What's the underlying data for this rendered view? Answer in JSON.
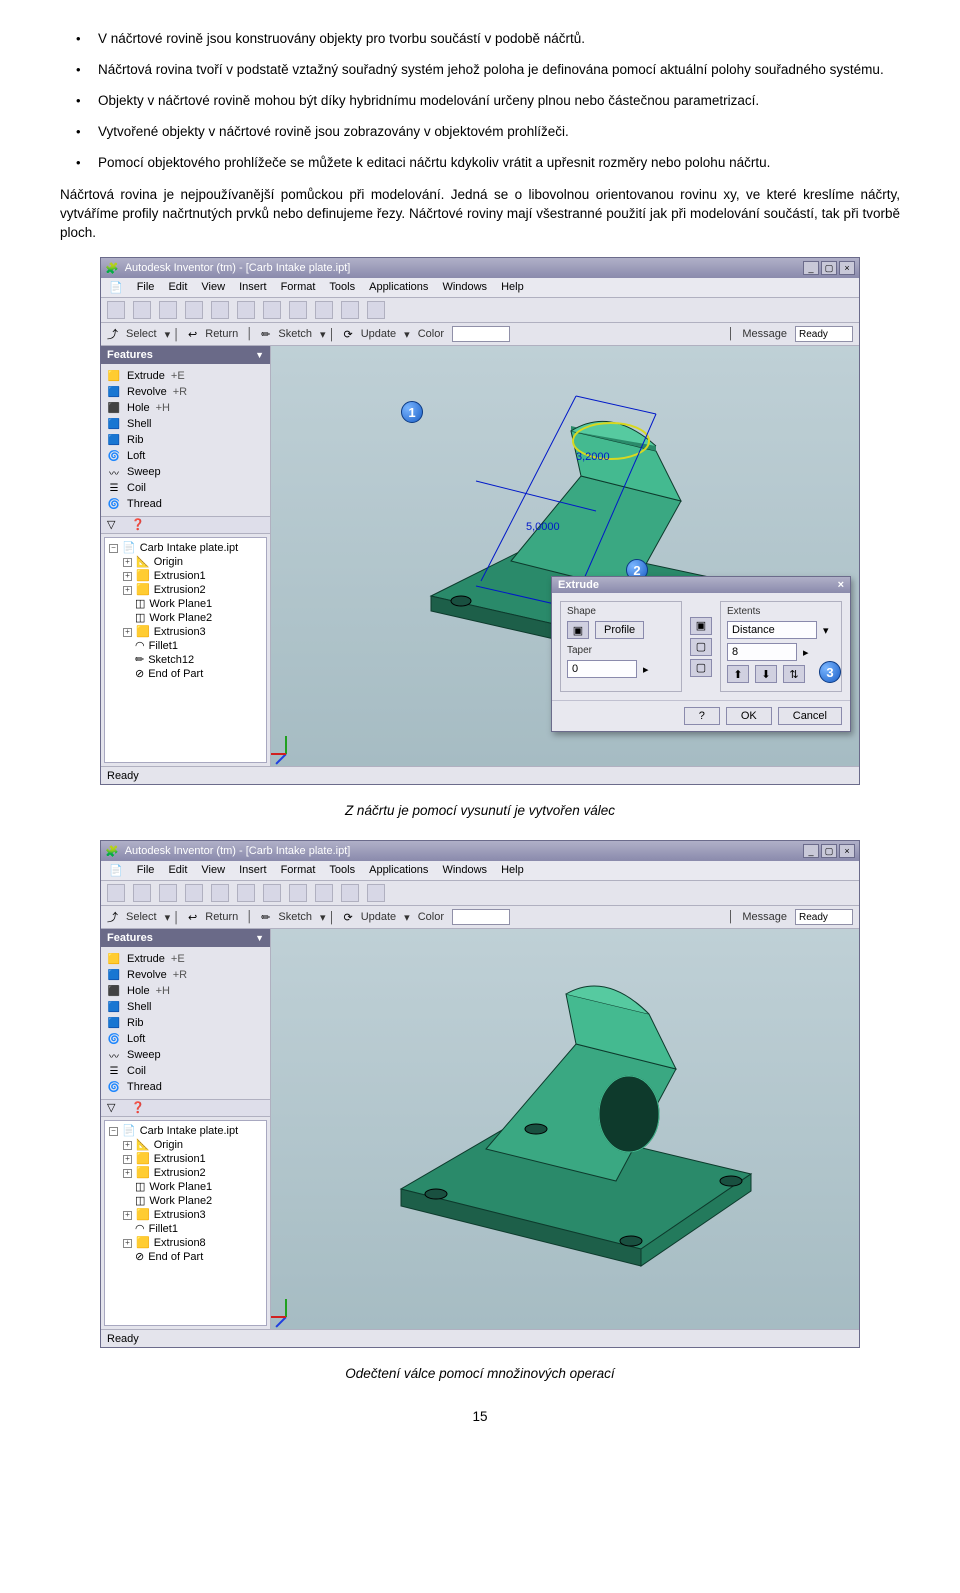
{
  "bullets": [
    "V náčrtové rovině jsou konstruovány objekty pro tvorbu součástí v podobě náčrtů.",
    "Náčrtová rovina tvoří v podstatě vztažný souřadný systém jehož poloha je definována pomocí aktuální polohy souřadného systému.",
    "Objekty v náčrtové rovině mohou být díky hybridnímu modelování určeny plnou nebo částečnou parametrizací.",
    "Vytvořené objekty v náčrtové rovině jsou zobrazovány v objektovém prohlížeči.",
    "Pomocí objektového prohlížeče se můžete k editaci náčrtu kdykoliv vrátit a upřesnit rozměry nebo polohu náčrtu."
  ],
  "paragraph": "Náčrtová rovina je nejpoužívanější pomůckou při modelování. Jedná se o libovolnou orientovanou rovinu xy, ve které kreslíme náčrty, vytváříme profily načrtnutých prvků nebo definujeme řezy. Náčrtové roviny mají všestranné použití jak při modelování součástí, tak při tvorbě ploch.",
  "caption1": "Z náčrtu je pomocí vysunutí je vytvořen válec",
  "caption2": "Odečtení válce pomocí množinových operací",
  "pagenum": "15",
  "app": {
    "title": "Autodesk Inventor (tm) - [Carb Intake plate.ipt]",
    "menus": [
      "File",
      "Edit",
      "View",
      "Insert",
      "Format",
      "Tools",
      "Applications",
      "Windows",
      "Help"
    ],
    "tb2": {
      "select": "Select",
      "return": "Return",
      "sketch": "Sketch",
      "update": "Update",
      "colorLbl": "Color",
      "color": " ",
      "message": "Message",
      "ready": "Ready"
    },
    "panelHead": "Features",
    "features": [
      {
        "icon": "🟨",
        "label": "Extrude",
        "key": "+E"
      },
      {
        "icon": "🟦",
        "label": "Revolve",
        "key": "+R"
      },
      {
        "icon": "⬛",
        "label": "Hole",
        "key": "+H"
      },
      {
        "icon": "🟦",
        "label": "Shell",
        "key": ""
      },
      {
        "icon": "🟦",
        "label": "Rib",
        "key": ""
      },
      {
        "icon": "🌀",
        "label": "Loft",
        "key": ""
      },
      {
        "icon": "〰",
        "label": "Sweep",
        "key": ""
      },
      {
        "icon": "☰",
        "label": "Coil",
        "key": ""
      },
      {
        "icon": "🌀",
        "label": "Thread",
        "key": ""
      }
    ],
    "tree": [
      {
        "pm": "−",
        "indent": 0,
        "icon": "📄",
        "label": "Carb Intake plate.ipt"
      },
      {
        "pm": "+",
        "indent": 1,
        "icon": "📐",
        "label": "Origin"
      },
      {
        "pm": "+",
        "indent": 1,
        "icon": "🟨",
        "label": "Extrusion1"
      },
      {
        "pm": "+",
        "indent": 1,
        "icon": "🟨",
        "label": "Extrusion2"
      },
      {
        "pm": "",
        "indent": 1,
        "icon": "◫",
        "label": "Work Plane1"
      },
      {
        "pm": "",
        "indent": 1,
        "icon": "◫",
        "label": "Work Plane2"
      },
      {
        "pm": "+",
        "indent": 1,
        "icon": "🟨",
        "label": "Extrusion3"
      },
      {
        "pm": "",
        "indent": 1,
        "icon": "◠",
        "label": "Fillet1"
      },
      {
        "pm": "",
        "indent": 1,
        "icon": "✏",
        "label": "Sketch12"
      },
      {
        "pm": "",
        "indent": 1,
        "icon": "⊘",
        "label": "End of Part"
      }
    ],
    "tree2": [
      {
        "pm": "−",
        "indent": 0,
        "icon": "📄",
        "label": "Carb Intake plate.ipt"
      },
      {
        "pm": "+",
        "indent": 1,
        "icon": "📐",
        "label": "Origin"
      },
      {
        "pm": "+",
        "indent": 1,
        "icon": "🟨",
        "label": "Extrusion1"
      },
      {
        "pm": "+",
        "indent": 1,
        "icon": "🟨",
        "label": "Extrusion2"
      },
      {
        "pm": "",
        "indent": 1,
        "icon": "◫",
        "label": "Work Plane1"
      },
      {
        "pm": "",
        "indent": 1,
        "icon": "◫",
        "label": "Work Plane2"
      },
      {
        "pm": "+",
        "indent": 1,
        "icon": "🟨",
        "label": "Extrusion3"
      },
      {
        "pm": "",
        "indent": 1,
        "icon": "◠",
        "label": "Fillet1"
      },
      {
        "pm": "+",
        "indent": 1,
        "icon": "🟨",
        "label": "Extrusion8"
      },
      {
        "pm": "",
        "indent": 1,
        "icon": "⊘",
        "label": "End of Part"
      }
    ],
    "status": "Ready",
    "dims": {
      "d1": "3,2000",
      "d2": "5,0000",
      "d3": "3,2000"
    },
    "badges": {
      "b1": "1",
      "b2": "2",
      "b3": "3"
    },
    "dialog": {
      "title": "Extrude",
      "shape": "Shape",
      "profile": "Profile",
      "taper": "Taper",
      "taperVal": "0",
      "extents": "Extents",
      "mode": "Distance",
      "dist": "8",
      "ok": "OK",
      "cancel": "Cancel"
    }
  }
}
